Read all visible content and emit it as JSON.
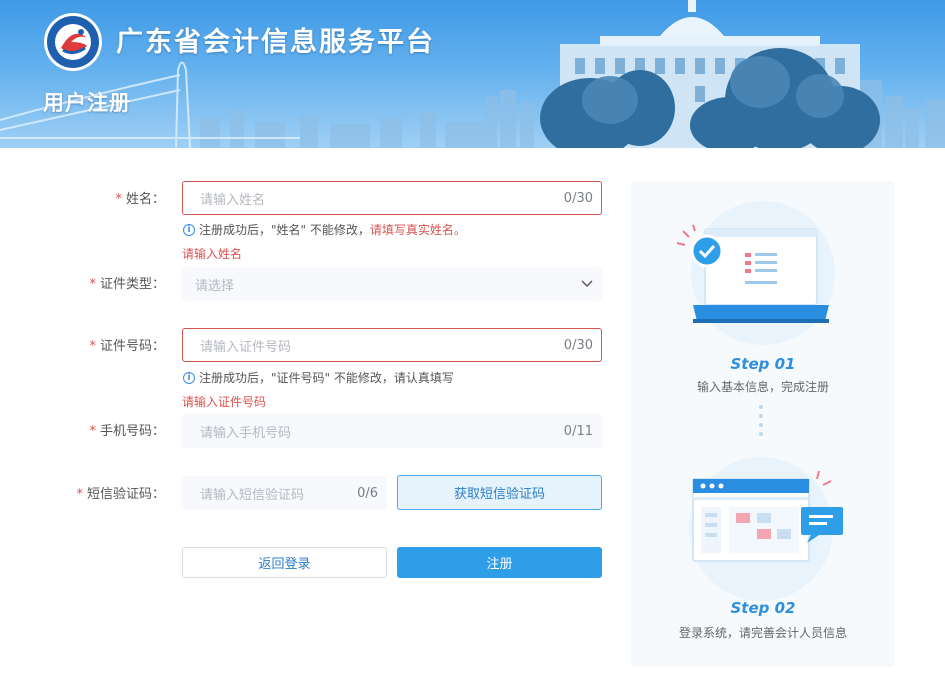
{
  "header": {
    "site_title": "广东省会计信息服务平台",
    "page_title": "用户注册"
  },
  "form": {
    "name": {
      "label": "姓名：",
      "placeholder": "请输入姓名",
      "count": "0/30",
      "hint_prefix": "注册成功后，\"姓名\" 不能修改，",
      "hint_warning": "请填写真实姓名。",
      "error": "请输入姓名"
    },
    "id_type": {
      "label": "证件类型：",
      "placeholder": "请选择"
    },
    "id_number": {
      "label": "证件号码：",
      "placeholder": "请输入证件号码",
      "count": "0/30",
      "hint": "注册成功后，\"证件号码\" 不能修改，请认真填写",
      "error": "请输入证件号码"
    },
    "phone": {
      "label": "手机号码：",
      "placeholder": "请输入手机号码",
      "count": "0/11"
    },
    "sms": {
      "label": "短信验证码：",
      "placeholder": "请输入短信验证码",
      "count": "0/6",
      "button": "获取短信验证码"
    },
    "required_mark": "*",
    "back_button": "返回登录",
    "register_button": "注册"
  },
  "steps": [
    {
      "title": "Step 01",
      "desc": "输入基本信息，完成注册"
    },
    {
      "title": "Step 02",
      "desc": "登录系统，请完善会计人员信息"
    }
  ],
  "colors": {
    "primary": "#2f9ee8",
    "error": "#d9534f",
    "step_title": "#2f8fdc"
  }
}
